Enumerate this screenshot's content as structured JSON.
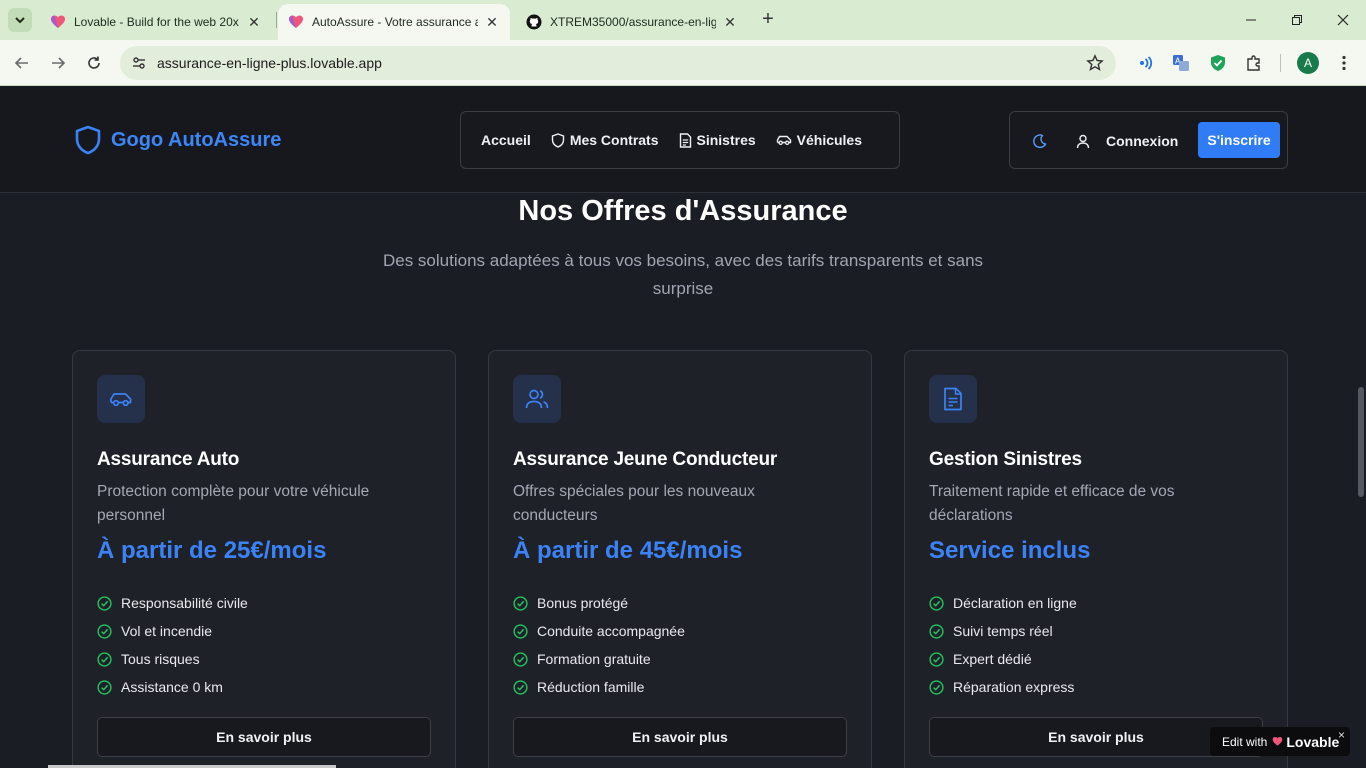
{
  "browser": {
    "tabs": [
      {
        "title": "Lovable - Build for the web 20x faster",
        "active": false
      },
      {
        "title": "AutoAssure - Votre assurance auto en ligne",
        "active": true
      },
      {
        "title": "XTREM35000/assurance-en-ligne",
        "active": false
      }
    ],
    "url": "assurance-en-ligne-plus.lovable.app",
    "profile_initial": "A"
  },
  "header": {
    "logo_text": "Gogo AutoAssure",
    "nav": [
      {
        "label": "Accueil",
        "icon": "none"
      },
      {
        "label": "Mes Contrats",
        "icon": "shield-icon"
      },
      {
        "label": "Sinistres",
        "icon": "document-icon"
      },
      {
        "label": "Véhicules",
        "icon": "car-icon"
      }
    ],
    "login_label": "Connexion",
    "signup_label": "S'inscrire"
  },
  "offers": {
    "title": "Nos Offres d'Assurance",
    "subtitle": "Des solutions adaptées à tous vos besoins, avec des tarifs transparents et sans surprise",
    "cards": [
      {
        "icon": "car-icon",
        "title": "Assurance Auto",
        "description": "Protection complète pour votre véhicule personnel",
        "price": "À partir de 25€/mois",
        "features": [
          "Responsabilité civile",
          "Vol et incendie",
          "Tous risques",
          "Assistance 0 km"
        ],
        "button": "En savoir plus"
      },
      {
        "icon": "users-icon",
        "title": "Assurance Jeune Conducteur",
        "description": "Offres spéciales pour les nouveaux conducteurs",
        "price": "À partir de 45€/mois",
        "features": [
          "Bonus protégé",
          "Conduite accompagnée",
          "Formation gratuite",
          "Réduction famille"
        ],
        "button": "En savoir plus"
      },
      {
        "icon": "file-icon",
        "title": "Gestion Sinistres",
        "description": "Traitement rapide et efficace de vos déclarations",
        "price": "Service inclus",
        "features": [
          "Déclaration en ligne",
          "Suivi temps réel",
          "Expert dédié",
          "Réparation express"
        ],
        "button": "En savoir plus"
      }
    ]
  },
  "badge": {
    "prefix": "Edit with",
    "brand": "Lovable",
    "close": "×"
  },
  "colors": {
    "accent": "#3b82f6",
    "check": "#22c55e",
    "background": "#1b1d24"
  }
}
